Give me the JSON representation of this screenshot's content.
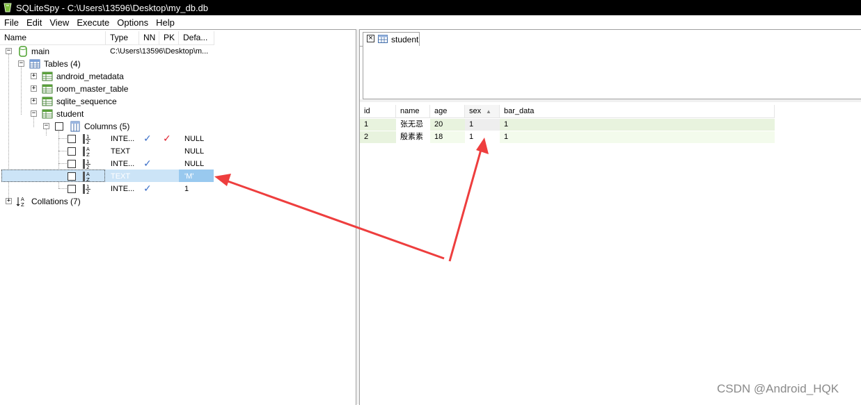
{
  "window": {
    "title": "SQLiteSpy - C:\\Users\\13596\\Desktop\\my_db.db"
  },
  "menu": [
    "File",
    "Edit",
    "View",
    "Execute",
    "Options",
    "Help"
  ],
  "tree": {
    "headers": {
      "name": "Name",
      "type": "Type",
      "nn": "NN",
      "pk": "PK",
      "default": "Defa..."
    },
    "db_name": "main",
    "db_path": "C:\\Users\\13596\\Desktop\\m...",
    "tables_label": "Tables (4)",
    "tables": [
      "android_metadata",
      "room_master_table",
      "sqlite_sequence",
      "student"
    ],
    "columns_label": "Columns (5)",
    "columns": [
      {
        "type": "INTE...",
        "nn": true,
        "pk": true,
        "default": "NULL",
        "selected": false
      },
      {
        "type": "TEXT",
        "nn": false,
        "pk": false,
        "default": "NULL",
        "selected": false
      },
      {
        "type": "INTE...",
        "nn": true,
        "pk": false,
        "default": "NULL",
        "selected": false
      },
      {
        "type": "TEXT",
        "nn": false,
        "pk": false,
        "default": "'M'",
        "selected": true
      },
      {
        "type": "INTE...",
        "nn": true,
        "pk": false,
        "default": "1",
        "selected": false
      }
    ],
    "collations_label": "Collations (7)"
  },
  "tab": {
    "label": "student",
    "close_glyph": "×"
  },
  "grid": {
    "headers": [
      "id",
      "name",
      "age",
      "sex",
      "bar_data"
    ],
    "rows": [
      [
        "1",
        "张无忌",
        "20",
        "1",
        "1"
      ],
      [
        "2",
        "殷素素",
        "18",
        "1",
        "1"
      ]
    ]
  },
  "watermark": "CSDN @Android_HQK",
  "colors": {
    "selection": "#cce4f7",
    "selection_default_cell": "#99c9ef",
    "row_odd": "#e8f3de",
    "row_even": "#f3fbec",
    "check_nn": "#3a6ec8",
    "check_pk": "#e0202e",
    "arrow": "#ee3e3e"
  }
}
